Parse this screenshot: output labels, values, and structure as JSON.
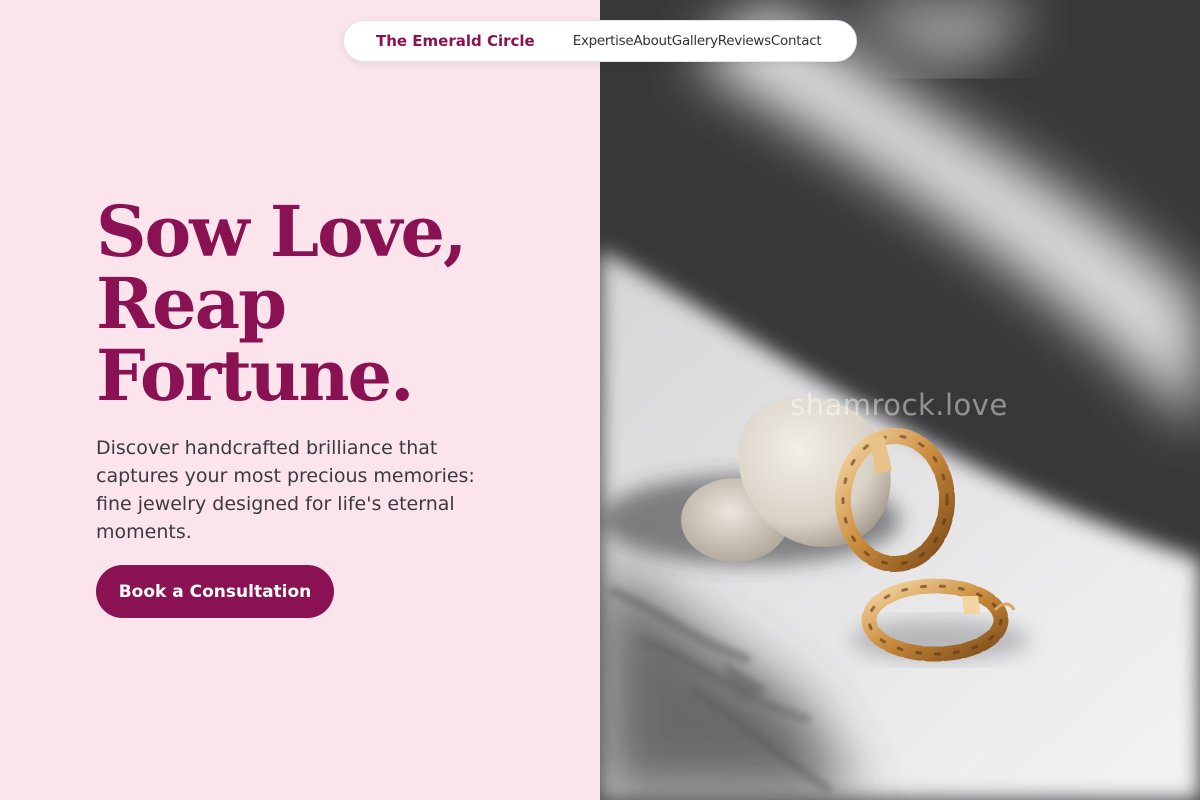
{
  "nav": {
    "brand": "The Emerald Circle",
    "links": [
      "Expertise",
      "About",
      "Gallery",
      "Reviews",
      "Contact"
    ]
  },
  "hero": {
    "title_lines": [
      "Sow Love,",
      "Reap",
      "Fortune."
    ],
    "description": "Discover handcrafted brilliance that captures your most precious memories: fine jewelry designed for life's eternal moments.",
    "cta_label": "Book a Consultation"
  },
  "image": {
    "watermark": "shamrock.love",
    "subject": "gold-twisted-hoop-earrings-on-stone"
  },
  "colors": {
    "accent": "#8a1253",
    "left_background": "#fbe4ec",
    "body_text": "#3d3a3f"
  }
}
